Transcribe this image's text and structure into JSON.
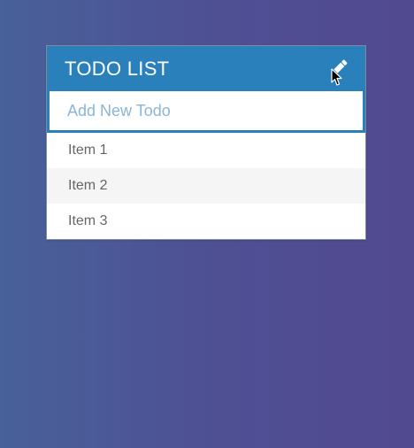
{
  "header": {
    "title": "TODO LIST",
    "edit_icon": "pencil-icon"
  },
  "input": {
    "value": "",
    "placeholder": "Add New Todo"
  },
  "todos": [
    {
      "label": "Item 1"
    },
    {
      "label": "Item 2"
    },
    {
      "label": "Item 3"
    }
  ],
  "colors": {
    "header_bg": "#2a80bb",
    "placeholder": "#8ab5d8",
    "item_text": "#666666",
    "stripe": "#f5f5f5"
  }
}
